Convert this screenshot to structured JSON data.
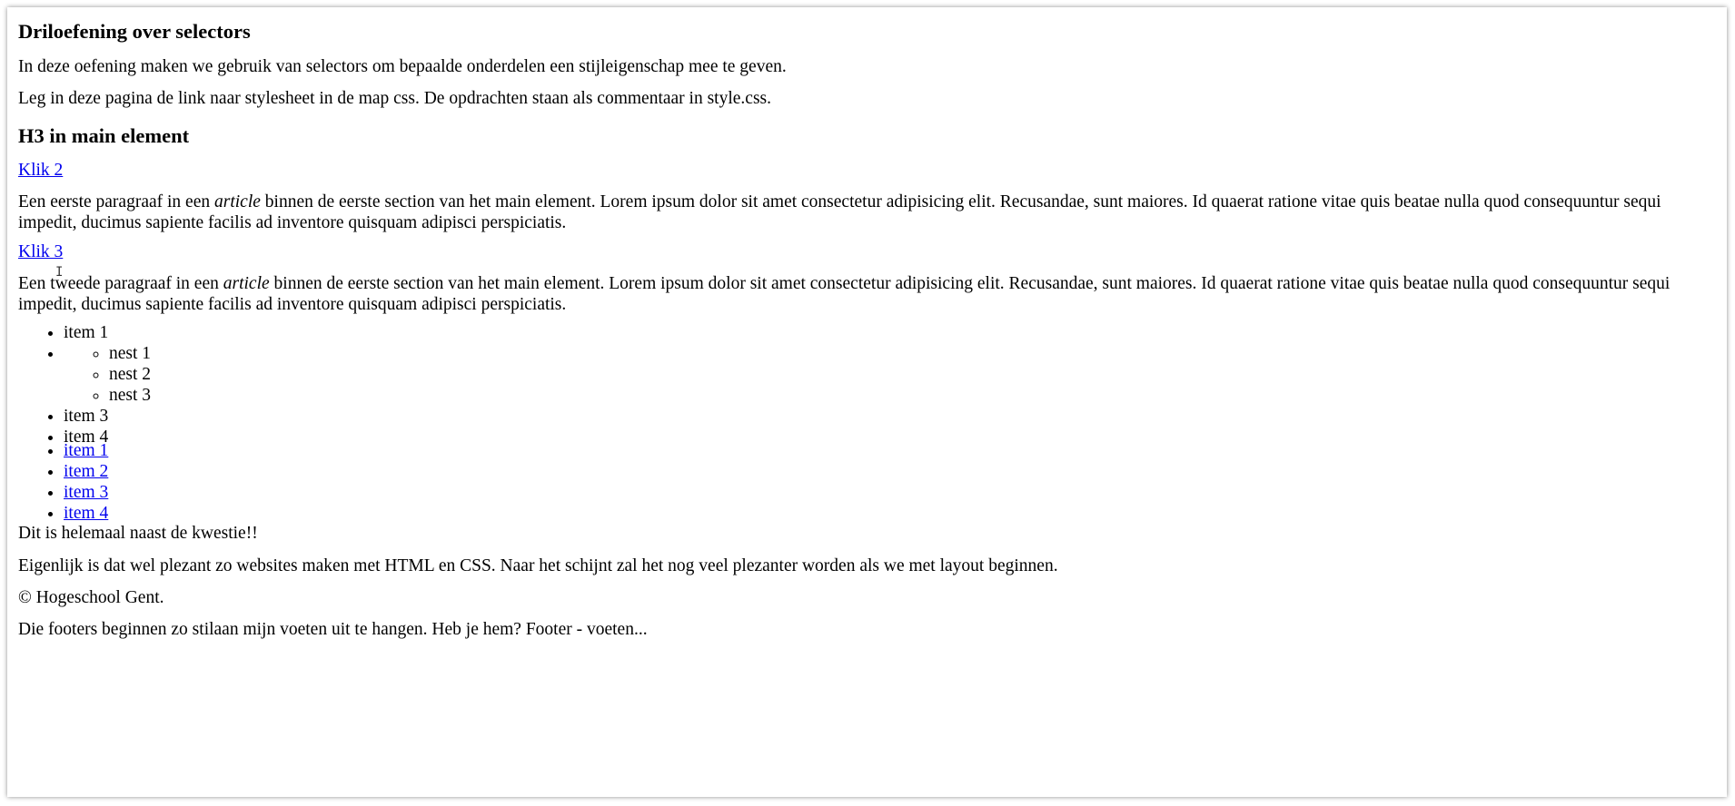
{
  "heading1": "Driloefening over selectors",
  "intro1": "In deze oefening maken we gebruik van selectors om bepaalde onderdelen een stijleigenschap mee te geven.",
  "intro2": "Leg in deze pagina de link naar stylesheet in de map css. De opdrachten staan als commentaar in style.css.",
  "heading2": "H3 in main element",
  "link_klik2": "Klik 2",
  "para1": {
    "before": "Een eerste paragraaf in een ",
    "em": "article",
    "after": " binnen de eerste section van het main element. Lorem ipsum dolor sit amet consectetur adipisicing elit. Recusandae, sunt maiores. Id quaerat ratione vitae quis beatae nulla quod consequuntur sequi impedit, ducimus sapiente facilis ad inventore quisquam adipisci perspiciatis."
  },
  "link_klik3": "Klik 3",
  "para2": {
    "before": "Een tweede paragraaf in een ",
    "em": "article",
    "after": " binnen de eerste section van het main element. Lorem ipsum dolor sit amet consectetur adipisicing elit. Recusandae, sunt maiores. Id quaerat ratione vitae quis beatae nulla quod consequuntur sequi impedit, ducimus sapiente facilis ad inventore quisquam adipisci perspiciatis."
  },
  "list1": {
    "item1": "item 1",
    "nested": [
      "nest 1",
      "nest 2",
      "nest 3"
    ],
    "item3": "item 3",
    "item4": "item 4"
  },
  "list2": [
    "item 1",
    "item 2",
    "item 3",
    "item 4"
  ],
  "aside_text": "Dit is helemaal naast de kwestie!!",
  "closing_text": "Eigenlijk is dat wel plezant zo websites maken met HTML en CSS. Naar het schijnt zal het nog veel plezanter worden als we met layout beginnen.",
  "footer_copyright": "© Hogeschool Gent.",
  "footer_joke": "Die footers beginnen zo stilaan mijn voeten uit te hangen. Heb je hem? Footer - voeten...",
  "colors": {
    "link": "#0000ee",
    "text": "#000000",
    "background": "#ffffff"
  }
}
